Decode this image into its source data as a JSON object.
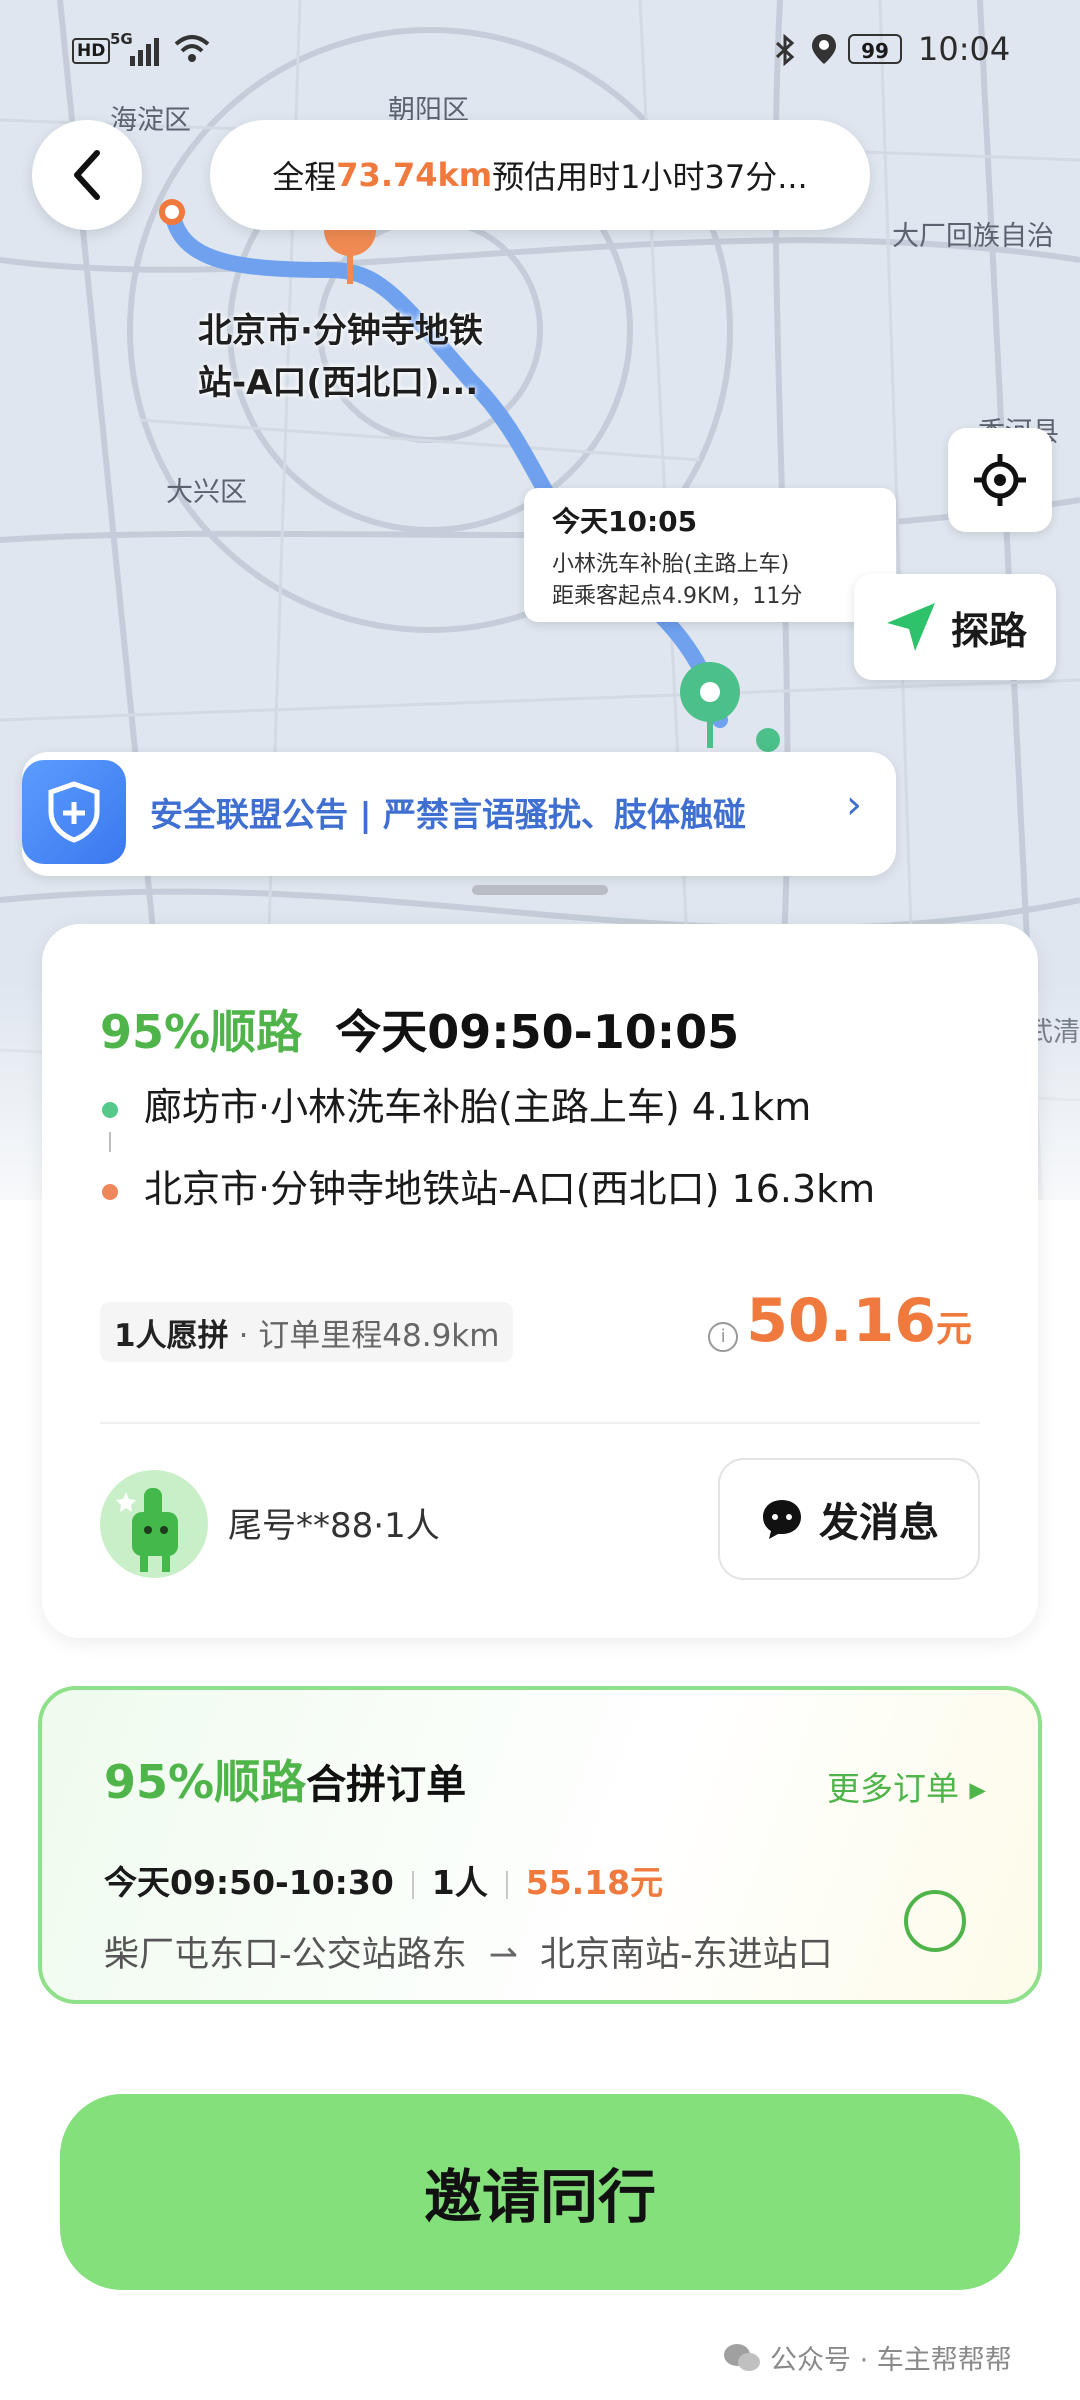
{
  "status_bar": {
    "time": "10:04",
    "battery": "99",
    "hd": "HD",
    "network": "5G"
  },
  "map": {
    "places": [
      "海淀区",
      "朝阳区",
      "大厂回族自治",
      "香河县",
      "大兴区",
      "武清"
    ],
    "route_summary": {
      "prefix": "全程",
      "distance": "73.74km",
      "eta": " 预估用时1小时37分..."
    },
    "destination_label_line1": "北京市·分钟寺地铁",
    "destination_label_line2": "站-A口(西北口)...",
    "pickup_bubble": {
      "time": "今天10:05",
      "place": "小林洗车补胎(主路上车)",
      "distance": "距乘客起点4.9KM，11分"
    },
    "explore_label": "探路"
  },
  "notice": {
    "text": "安全联盟公告 | 严禁言语骚扰、肢体触碰"
  },
  "order": {
    "match_pct": "95%顺路",
    "time_range": "今天09:50-10:05",
    "pickup": "廊坊市·小林洗车补胎(主路上车) 4.1km",
    "dropoff": "北京市·分钟寺地铁站-A口(西北口) 16.3km",
    "chip_main": "1人愿拼",
    "chip_sub": "· 订单里程48.9km",
    "price": "50.16",
    "price_unit": "元",
    "passenger": "尾号**88·1人",
    "message_label": "发消息"
  },
  "combined": {
    "match_pct": "95%顺路",
    "title": "合拼订单",
    "more_label": "更多订单 ▸",
    "time": "今天09:50-10:30",
    "people": "1人",
    "price": "55.18元",
    "from": "柴厂屯东口-公交站路东",
    "to": "北京南站-东进站口"
  },
  "invite_label": "邀请同行",
  "watermark": "公众号 · 车主帮帮帮",
  "colors": {
    "accent_green": "#4fb54a",
    "orange": "#f07a3e",
    "button_green": "#84e07b",
    "notice_blue": "#3f6fd1"
  }
}
